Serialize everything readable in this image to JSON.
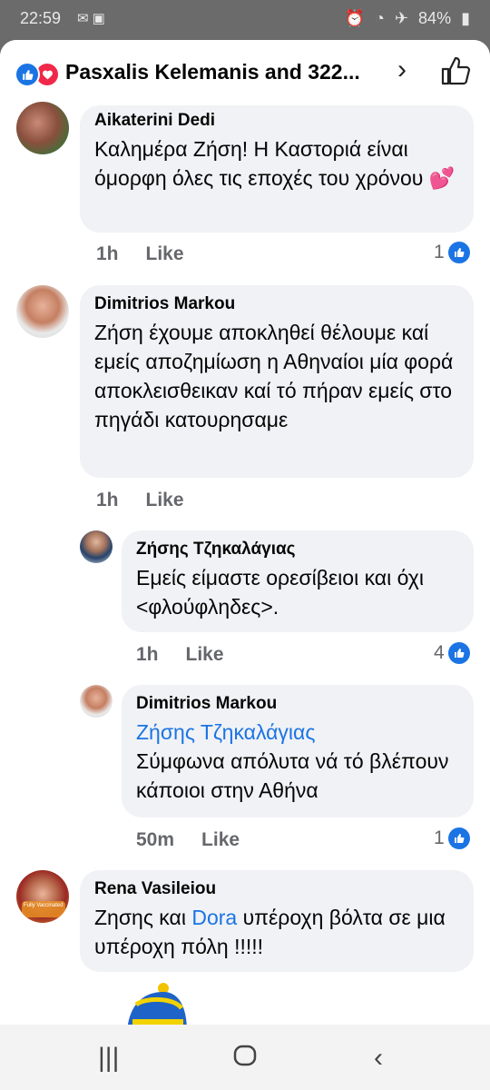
{
  "status_bar": {
    "time": "22:59",
    "notification_icons": [
      "mail-icon",
      "app-icon"
    ],
    "system_icons": [
      "alarm-icon",
      "wifi-icon",
      "airplane-icon",
      "battery-icon"
    ],
    "battery": "84%"
  },
  "header": {
    "reaction_icons": [
      "like-reaction-icon",
      "love-reaction-icon"
    ],
    "title": "Pasxalis Kelemanis and 322..."
  },
  "comments": [
    {
      "author": "Aikaterini Dedi",
      "text": "Καλημέρα Ζήση! Η Καστοριά είναι όμορφη όλες τις εποχές του χρόνου",
      "emoji": "💕",
      "time": "1h",
      "like_label": "Like",
      "reactions": "1"
    },
    {
      "author": "Dimitrios Markou",
      "text": "Ζήση έχουμε αποκληθεί θέλουμε καί εμείς αποζημίωση η Αθηναίοι μία φορά αποκλεισθεικαν καί τό πήραν εμείς στο πηγάδι κατουρησαμε",
      "time": "1h",
      "like_label": "Like",
      "reactions": ""
    },
    {
      "author": "Ζήσης Τζηκαλάγιας",
      "text": "Εμείς είμαστε ορεσίβειοι και όχι <φλούφληδες>.",
      "time": "1h",
      "like_label": "Like",
      "reactions": "4"
    },
    {
      "author": "Dimitrios Markou",
      "mention": "Ζήσης Τζηκαλάγιας",
      "text": "Σύμφωνα απόλυτα νά τό βλέπουν κάποιοι στην Αθήνα",
      "time": "50m",
      "like_label": "Like",
      "reactions": "1"
    },
    {
      "author": "Rena Vasileiou",
      "text_before": "Ζησης και",
      "mention": "Dora",
      "text_after": "υπέροχη βόλτα σε μια υπέροχη πόλη !!!!!",
      "avatar_badge": "Fully Vaccinated"
    }
  ],
  "nav_bar": {
    "icons": [
      "recent-apps-icon",
      "home-icon",
      "back-icon"
    ]
  },
  "colors": {
    "accent": "#1b74e4",
    "love": "#f0284a",
    "bubble": "#f0f2f5",
    "meta_text": "#65676b"
  }
}
